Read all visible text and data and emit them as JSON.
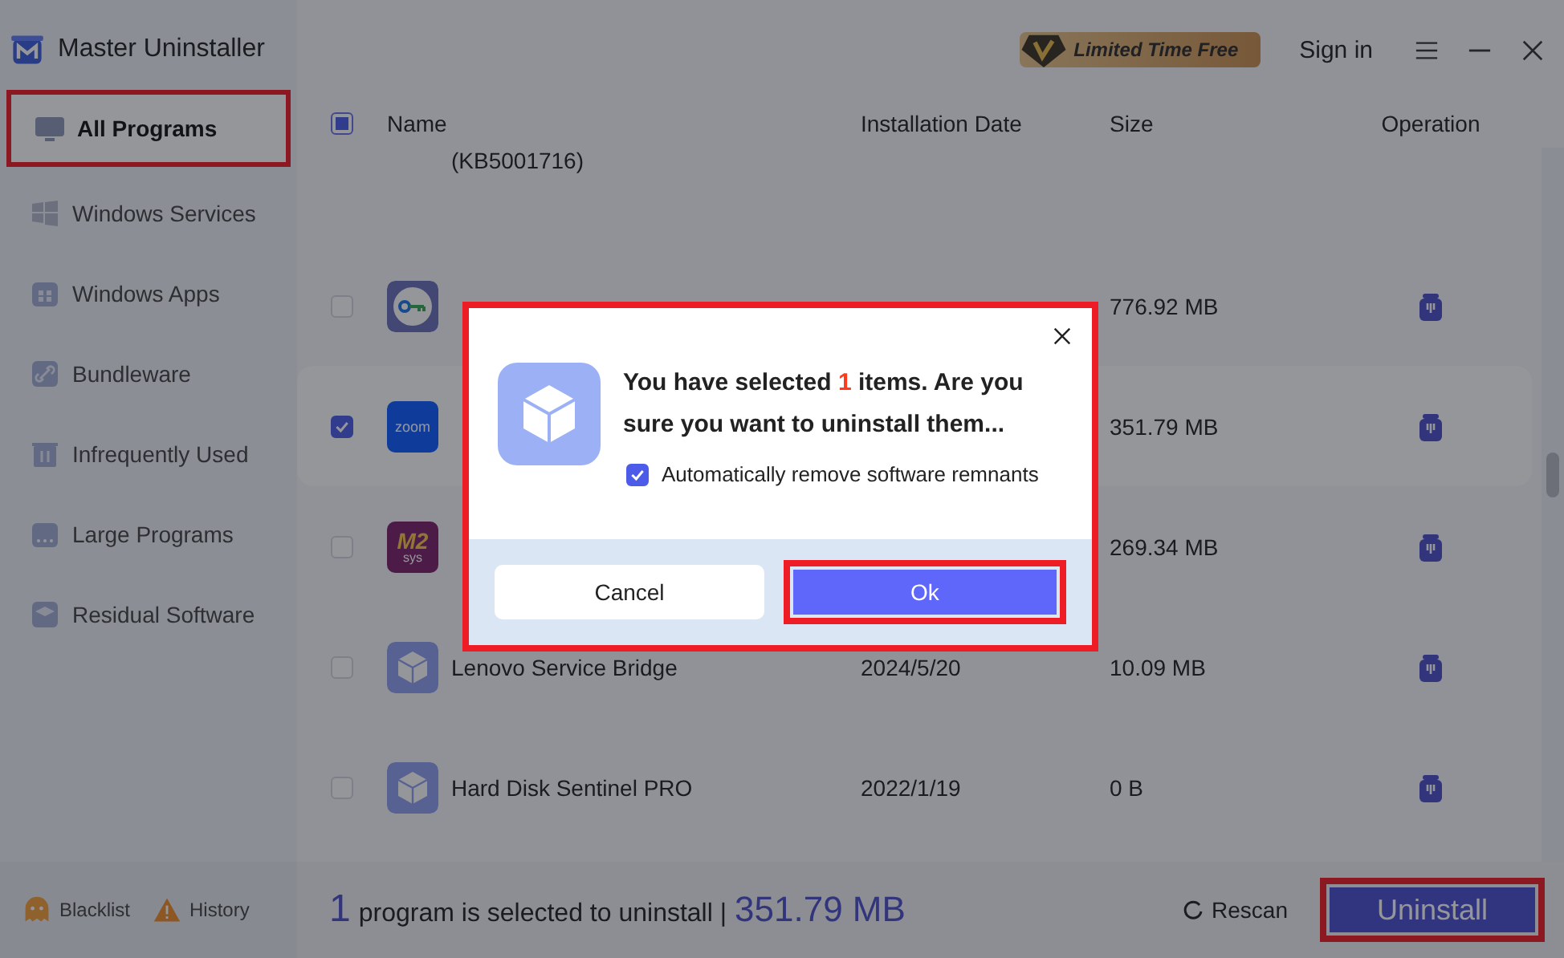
{
  "app": {
    "title": "Master Uninstaller",
    "promo": "Limited Time Free",
    "sign_in": "Sign in"
  },
  "sidebar": {
    "items": [
      {
        "label": "All Programs",
        "selected": true,
        "highlighted": true
      },
      {
        "label": "Windows Services",
        "selected": false,
        "highlighted": false
      },
      {
        "label": "Windows Apps",
        "selected": false,
        "highlighted": false
      },
      {
        "label": "Bundleware",
        "selected": false,
        "highlighted": false
      },
      {
        "label": "Infrequently Used",
        "selected": false,
        "highlighted": false
      },
      {
        "label": "Large Programs",
        "selected": false,
        "highlighted": false
      },
      {
        "label": "Residual Software",
        "selected": false,
        "highlighted": false
      }
    ]
  },
  "table": {
    "select_all_partial": true,
    "columns": [
      "Name",
      "Installation Date",
      "Size",
      "Operation"
    ],
    "rows": [
      {
        "kind": "partial",
        "name": "(KB5001716)"
      },
      {
        "kind": "key",
        "size": "776.92 MB",
        "checked": false
      },
      {
        "kind": "zoom",
        "icon_label": "zoom",
        "size": "351.79 MB",
        "checked": true
      },
      {
        "kind": "m2",
        "icon_label": "M2",
        "icon_sublabel": "sys",
        "size": "269.34 MB",
        "checked": false
      },
      {
        "kind": "box",
        "name": "Lenovo Service Bridge",
        "date": "2024/5/20",
        "size": "10.09 MB",
        "checked": false
      },
      {
        "kind": "box",
        "name": "Hard Disk Sentinel PRO",
        "date": "2022/1/19",
        "size": "0 B",
        "checked": false
      }
    ]
  },
  "footer": {
    "blacklist": "Blacklist",
    "history": "History",
    "count": "1",
    "summary": "program is selected to uninstall |",
    "total": "351.79 MB",
    "rescan": "Rescan",
    "uninstall": {
      "label": "Uninstall",
      "highlighted": true
    }
  },
  "dialog": {
    "highlighted": true,
    "message_before": "You have selected ",
    "count": "1",
    "message_after": " items. Are you sure you want to uninstall them...",
    "option": {
      "label": "Automatically remove software remnants",
      "checked": true
    },
    "buttons": [
      {
        "label": "Cancel",
        "kind": "secondary",
        "highlighted": false
      },
      {
        "label": "Ok",
        "kind": "primary",
        "highlighted": true
      }
    ]
  }
}
